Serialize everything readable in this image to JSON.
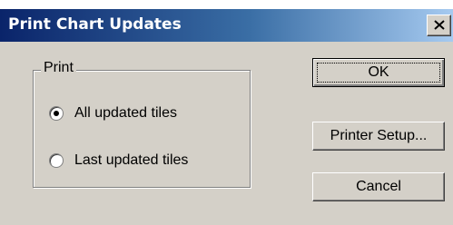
{
  "window": {
    "title": "Print Chart Updates",
    "close_symbol": "close-icon"
  },
  "print_group": {
    "label": "Print",
    "options": [
      {
        "label": "All updated tiles",
        "selected": true
      },
      {
        "label": "Last updated tiles",
        "selected": false
      }
    ]
  },
  "buttons": {
    "ok": "OK",
    "printer_setup": "Printer Setup...",
    "cancel": "Cancel"
  },
  "colors": {
    "dialog_bg": "#d4d0c8",
    "titlebar_start": "#0a246a",
    "titlebar_end": "#a6caf0"
  }
}
